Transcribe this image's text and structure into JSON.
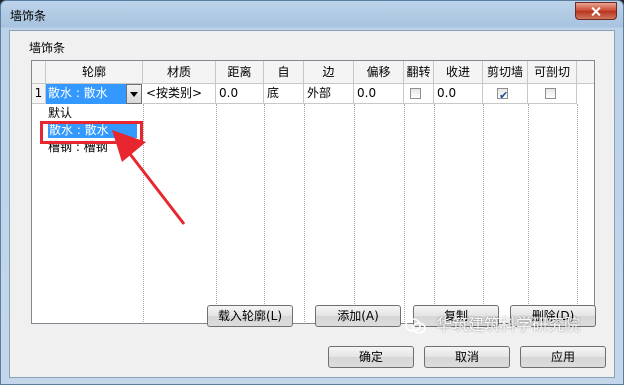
{
  "window": {
    "title": "墙饰条"
  },
  "group": {
    "label": "墙饰条"
  },
  "table": {
    "headers": [
      "轮廓",
      "材质",
      "距离",
      "自",
      "边",
      "偏移",
      "翻转",
      "收进",
      "剪切墙",
      "可剖切"
    ],
    "row": {
      "index": "1",
      "profile": "散水 : 散水",
      "material": "<按类别>",
      "distance": "0.0",
      "from": "底",
      "side": "外部",
      "offset": "0.0",
      "flip": false,
      "setback": "0.0",
      "cut_wall": true,
      "cuttable": false
    }
  },
  "dropdown": {
    "options": [
      "默认",
      "散水 : 散水",
      "槽钢 : 槽钢"
    ],
    "selected_index": 1
  },
  "buttons": {
    "load_profile": "载入轮廓(L)",
    "add": "添加(A)",
    "copy": "复制",
    "delete": "删除(D)",
    "ok": "确定",
    "cancel": "取消",
    "apply": "应用"
  },
  "watermark": {
    "text": "华筑建筑科学研究院"
  },
  "colors": {
    "highlight": "#3399ff",
    "annotation": "#e8262f"
  }
}
